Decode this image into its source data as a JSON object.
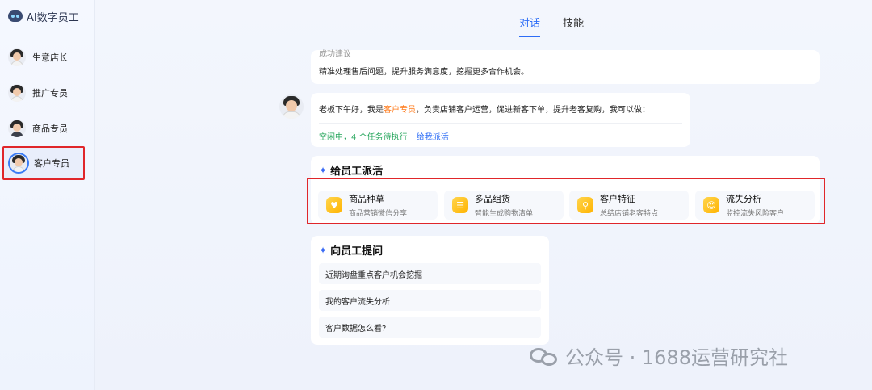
{
  "sidebar": {
    "brand": "AI数字员工",
    "items": [
      {
        "label": "生意店长"
      },
      {
        "label": "推广专员"
      },
      {
        "label": "商品专员"
      },
      {
        "label": "客户专员"
      }
    ]
  },
  "tabs": [
    "对话",
    "技能"
  ],
  "top_card": {
    "clipped": "成功建议",
    "text": "精准处理售后问题，提升服务满意度，挖掘更多合作机会。"
  },
  "agent_message": {
    "prefix": "老板下午好，我是",
    "name": "客户专员",
    "suffix": "，负责店铺客户运营，促进新客下单，提升老客复购，我可以做：",
    "status": "空闲中，4 个任务待执行",
    "dispatch_link": "给我派活"
  },
  "dispatch": {
    "title": "给员工派活",
    "tasks": [
      {
        "title": "商品种草",
        "desc": "商品营销微信分享"
      },
      {
        "title": "多品组货",
        "desc": "智能生成购物清单"
      },
      {
        "title": "客户特征",
        "desc": "总结店铺老客特点"
      },
      {
        "title": "流失分析",
        "desc": "监控流失风险客户"
      }
    ]
  },
  "ask": {
    "title": "向员工提问",
    "questions": [
      {
        "text": "近期询盘重点客户机会挖掘"
      },
      {
        "text": "我的客户流失分析"
      },
      {
        "text": "客户数据怎么看?"
      }
    ]
  },
  "watermark": "公众号 · 1688运营研究社",
  "colors": {
    "accent": "#2d6df6",
    "highlight": "#ff7a1a",
    "status": "#25a55b",
    "annotation": "#e0262a"
  }
}
